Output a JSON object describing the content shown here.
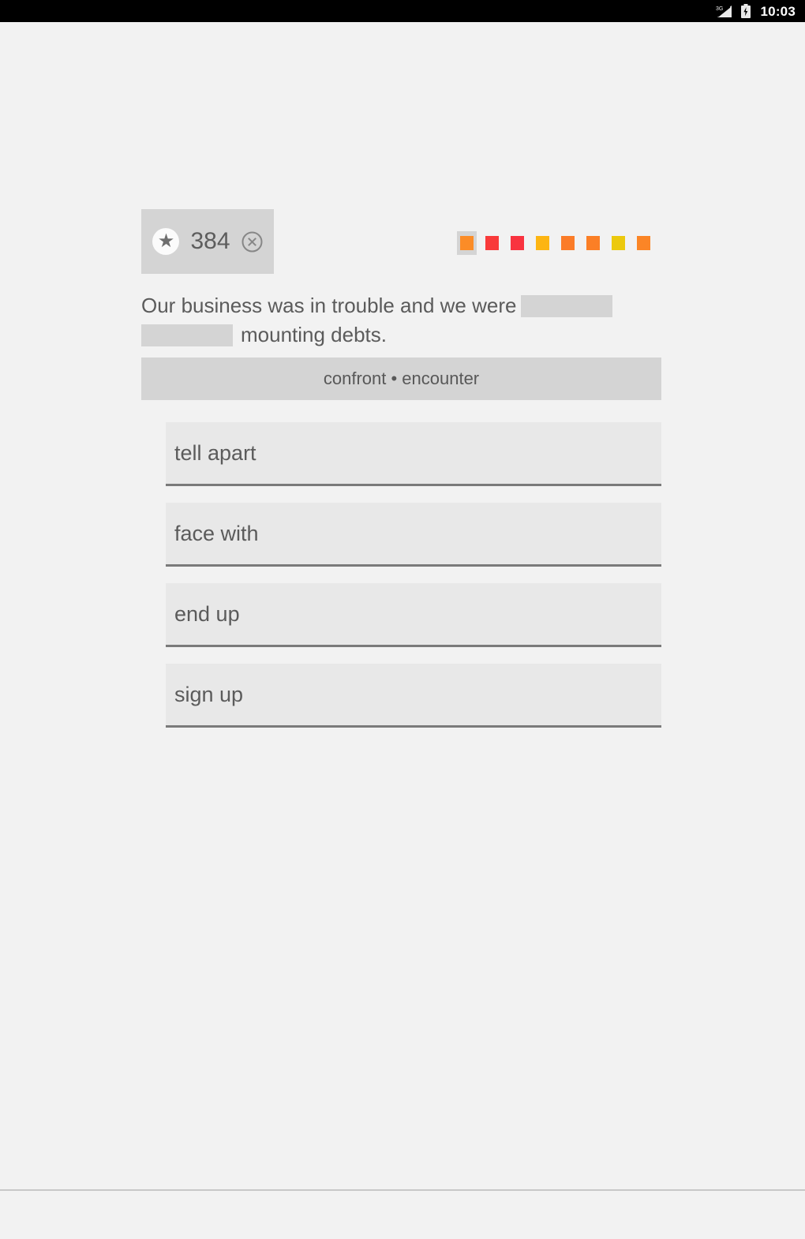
{
  "status_bar": {
    "time": "10:03",
    "signal_icon": "signal-cellular-icon",
    "signal_superscript": "3G",
    "battery_icon": "battery-charging-icon",
    "background": "#000000"
  },
  "score_badge": {
    "star_icon": "star-icon",
    "star_glyph": "★",
    "score": "384",
    "close_icon": "close-circle-icon",
    "background": "#d4d4d4"
  },
  "progress": {
    "active_index": 0,
    "cells": [
      {
        "color": "#fb8c27",
        "state": "active"
      },
      {
        "color": "#f93a3a",
        "state": "done"
      },
      {
        "color": "#f9333f",
        "state": "done"
      },
      {
        "color": "#fdb512",
        "state": "done"
      },
      {
        "color": "#fb7c28",
        "state": "done"
      },
      {
        "color": "#fb7f26",
        "state": "done"
      },
      {
        "color": "#ecc90d",
        "state": "done"
      },
      {
        "color": "#fb8526",
        "state": "done"
      },
      {
        "color": "#fb3b3d",
        "state": "clipped"
      }
    ]
  },
  "question": {
    "text_before": "Our business was in trouble and we were",
    "blank_one": "",
    "blank_two": "",
    "text_after": "mounting debts.",
    "blank_fill_color": "#d4d4d4"
  },
  "hint": {
    "text": "confront • encounter"
  },
  "options": [
    {
      "label": "tell apart"
    },
    {
      "label": "face with"
    },
    {
      "label": "end up"
    },
    {
      "label": "sign up"
    }
  ],
  "theme": {
    "page_background": "#f2f2f2",
    "option_background": "#e8e8e8",
    "option_underline": "#7a7a7a",
    "text_color": "#5b5b5b"
  }
}
